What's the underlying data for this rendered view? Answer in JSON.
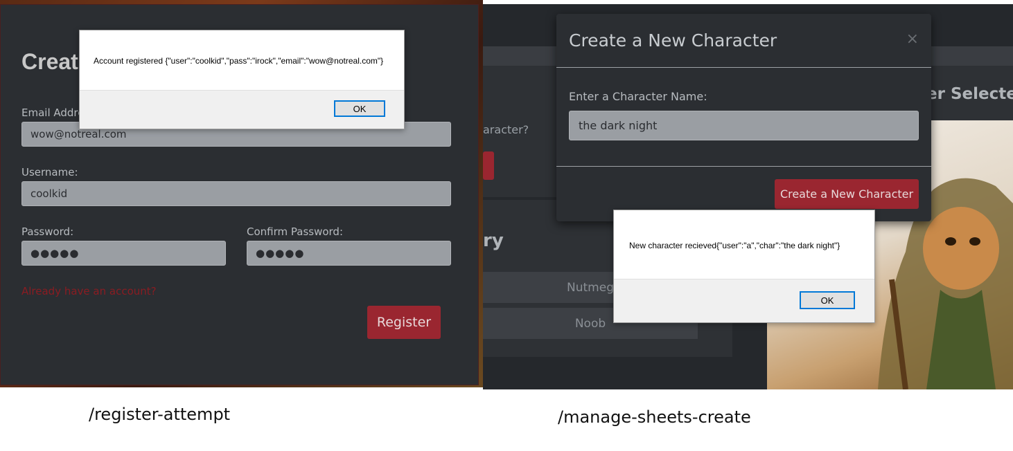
{
  "left": {
    "card_title": "Creat",
    "email_label": "Email Addre",
    "email_value": "wow@notreal.com",
    "username_label": "Username:",
    "username_value": "coolkid",
    "password_label": "Password:",
    "password_value": "●●●●●",
    "confirm_label": "Confirm Password:",
    "confirm_value": "●●●●●",
    "login_link": "Already have an account?",
    "register_button": "Register",
    "alert": {
      "message": "Account registered {\"user\":\"coolkid\",\"pass\":\"irock\",\"email\":\"wow@notreal.com\"}",
      "ok_label": "OK"
    }
  },
  "right": {
    "background": {
      "question_fragment": "aracter?",
      "heading_fragment": "ry",
      "selected_fragment": "er Selecte",
      "list_items": [
        "Nutmeg",
        "Noob"
      ]
    },
    "modal": {
      "title": "Create a New Character",
      "close_icon": "×",
      "name_label": "Enter a Character Name:",
      "name_value": "the dark night",
      "create_button": "Create a New Character"
    },
    "alert": {
      "message": "New character recieved{\"user\":\"a\",\"char\":\"the dark night\"}",
      "ok_label": "OK"
    }
  },
  "captions": {
    "left": "/register-attempt",
    "right": "/manage-sheets-create"
  }
}
